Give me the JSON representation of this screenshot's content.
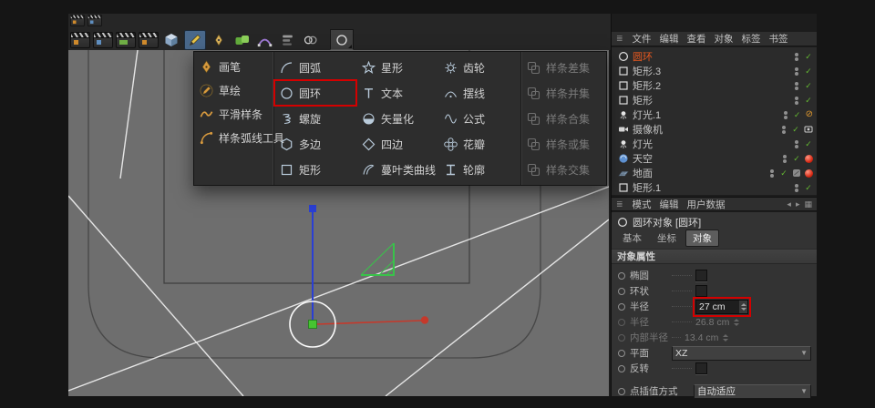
{
  "colors": {
    "annotation_red": "#d40000",
    "selected_object_orange": "#e8581f",
    "check_green": "#64b832",
    "viewport_gray": "#6e6e6e",
    "axis_blue": "#2a3fd4",
    "axis_red": "#c5392b",
    "axis_green": "#46c431",
    "angle_green": "#39c24a"
  },
  "toolbar": {
    "row1_icons": [
      "render-view-icon",
      "render-settings-icon"
    ],
    "row2_icons": [
      "render-active-view-icon",
      "render-region-icon",
      "render-picture-viewer-icon",
      "render-team-icon",
      "cube-primitive-icon",
      "spline-pen-icon",
      "pen-tool-icon",
      "generators-icon",
      "bezier-icon",
      "modifiers-icon",
      "boole-icon"
    ],
    "active_tool_button": "circle-spline-button"
  },
  "spline_menu": {
    "tools": [
      "画笔",
      "草绘",
      "平滑样条",
      "样条弧线工具"
    ],
    "col1": [
      "圆弧",
      "圆环",
      "螺旋",
      "多边",
      "矩形"
    ],
    "col2": [
      "星形",
      "文本",
      "矢量化",
      "四边",
      "蔓叶类曲线"
    ],
    "col3": [
      "齿轮",
      "摆线",
      "公式",
      "花瓣",
      "轮廓"
    ],
    "col4": [
      "样条差集",
      "样条并集",
      "样条合集",
      "样条或集",
      "样条交集"
    ],
    "highlighted_item": "圆环"
  },
  "object_manager": {
    "menu": [
      "文件",
      "编辑",
      "查看",
      "对象",
      "标签",
      "书签"
    ],
    "objects": [
      {
        "name": "圆环",
        "selected": true,
        "icon": "circle-spline"
      },
      {
        "name": "矩形.3",
        "icon": "rectangle-spline"
      },
      {
        "name": "矩形.2",
        "icon": "rectangle-spline"
      },
      {
        "name": "矩形",
        "icon": "rectangle-spline"
      },
      {
        "name": "灯光.1",
        "icon": "light"
      },
      {
        "name": "摄像机",
        "icon": "camera"
      },
      {
        "name": "灯光",
        "icon": "light"
      },
      {
        "name": "天空",
        "icon": "sky"
      },
      {
        "name": "地面",
        "icon": "floor"
      },
      {
        "name": "矩形.1",
        "icon": "rectangle-spline"
      }
    ]
  },
  "attribute_manager": {
    "menu": [
      "模式",
      "编辑",
      "用户数据"
    ],
    "title": "圆环对象 [圆环]",
    "tabs": [
      "基本",
      "坐标",
      "对象"
    ],
    "active_tab": "对象",
    "section_title": "对象属性",
    "properties": [
      {
        "label": "椭圆",
        "type": "checkbox",
        "checked": false
      },
      {
        "label": "环状",
        "type": "checkbox",
        "checked": false
      },
      {
        "label": "半径",
        "type": "number",
        "value": "27 cm",
        "highlighted": true
      },
      {
        "label": "半径",
        "type": "number",
        "value": "26.8 cm",
        "disabled": true
      },
      {
        "label": "内部半径",
        "type": "number",
        "value": "13.4 cm",
        "disabled": true
      },
      {
        "label": "平面",
        "type": "dropdown",
        "value": "XZ"
      },
      {
        "label": "反转",
        "type": "checkbox",
        "checked": false
      },
      {
        "label": "点插值方式",
        "type": "dropdown",
        "value": "自动适应"
      }
    ]
  }
}
